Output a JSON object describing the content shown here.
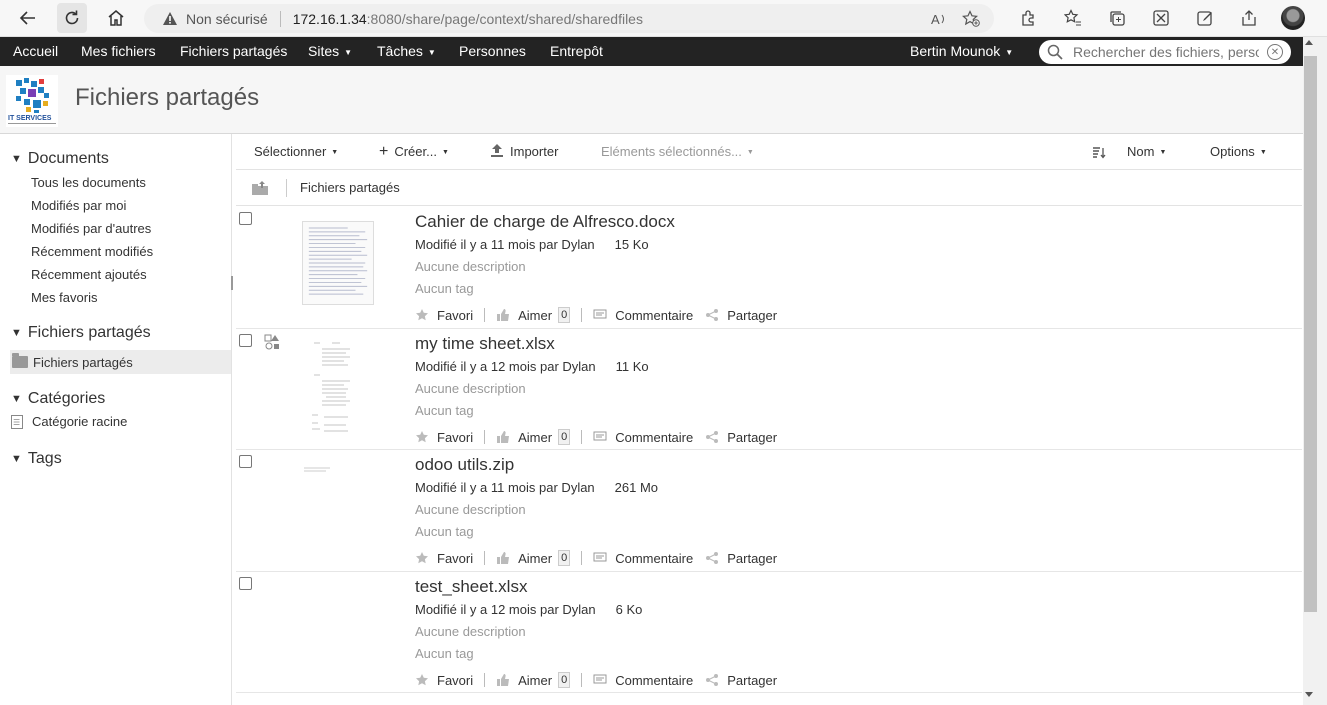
{
  "browser": {
    "security_label": "Non sécurisé",
    "url_host": "172.16.1.34",
    "url_rest": ":8080/share/page/context/shared/sharedfiles"
  },
  "nav": {
    "items": [
      {
        "label": "Accueil"
      },
      {
        "label": "Mes fichiers"
      },
      {
        "label": "Fichiers partagés"
      },
      {
        "label": "Sites"
      },
      {
        "label": "Tâches"
      },
      {
        "label": "Personnes"
      },
      {
        "label": "Entrepôt"
      }
    ],
    "user": "Bertin Mounok",
    "search_placeholder": "Rechercher des fichiers, perso",
    "caret": "▼"
  },
  "header": {
    "title": "Fichiers partagés",
    "logo_text": "IT SERVICES"
  },
  "sidebar": {
    "documents_title": "Documents",
    "documents_links": [
      "Tous les documents",
      "Modifiés par moi",
      "Modifiés par d'autres",
      "Récemment modifiés",
      "Récemment ajoutés",
      "Mes favoris"
    ],
    "shared_title": "Fichiers partagés",
    "shared_selected": "Fichiers partagés",
    "categories_title": "Catégories",
    "category_root": "Catégorie racine",
    "tags_title": "Tags",
    "triangle": "▼"
  },
  "toolbar": {
    "select": "Sélectionner",
    "create": "Créer...",
    "upload": "Importer",
    "selected_items": "Eléments sélectionnés...",
    "sort_field": "Nom",
    "options": "Options"
  },
  "breadcrumb": {
    "current": "Fichiers partagés"
  },
  "actions": {
    "favorite": "Favori",
    "like": "Aimer",
    "comment": "Commentaire",
    "share": "Partager"
  },
  "documents": [
    {
      "name": "Cahier de charge de Alfresco.docx",
      "modified": "Modifié il y a 11 mois par Dylan",
      "size": "15 Ko",
      "description": "Aucune description",
      "tags": "Aucun tag",
      "likes": "0"
    },
    {
      "name": "my time sheet.xlsx",
      "modified": "Modifié il y a 12 mois par Dylan",
      "size": "11 Ko",
      "description": "Aucune description",
      "tags": "Aucun tag",
      "likes": "0"
    },
    {
      "name": "odoo utils.zip",
      "modified": "Modifié il y a 11 mois par Dylan",
      "size": "261 Mo",
      "description": "Aucune description",
      "tags": "Aucun tag",
      "likes": "0"
    },
    {
      "name": "test_sheet.xlsx",
      "modified": "Modifié il y a 12 mois par Dylan",
      "size": "6 Ko",
      "description": "Aucune description",
      "tags": "Aucun tag",
      "likes": "0"
    }
  ]
}
